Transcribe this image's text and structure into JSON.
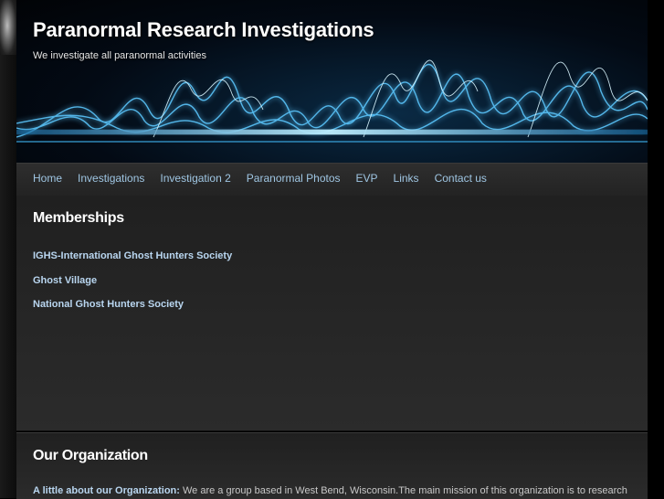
{
  "header": {
    "title": "Paranormal Research Investigations",
    "tagline": "We investigate all paranormal activities"
  },
  "nav": {
    "items": [
      {
        "label": "Home"
      },
      {
        "label": "Investigations"
      },
      {
        "label": "Investigation 2"
      },
      {
        "label": "Paranormal Photos"
      },
      {
        "label": "EVP"
      },
      {
        "label": "Links"
      },
      {
        "label": "Contact us"
      }
    ]
  },
  "memberships": {
    "heading": "Memberships",
    "items": [
      {
        "label": "IGHS-International Ghost Hunters Society"
      },
      {
        "label": "Ghost Village"
      },
      {
        "label": "National Ghost Hunters Society"
      }
    ]
  },
  "organization": {
    "heading": "Our Organization",
    "lead": "A little about our Organization:",
    "text": " We are a group based in West Bend, Wisconsin.The main mission of this organization is to research"
  },
  "colors": {
    "link": "#9fc6e3",
    "heading": "#ffffff",
    "wave": "#7fd4ff"
  }
}
